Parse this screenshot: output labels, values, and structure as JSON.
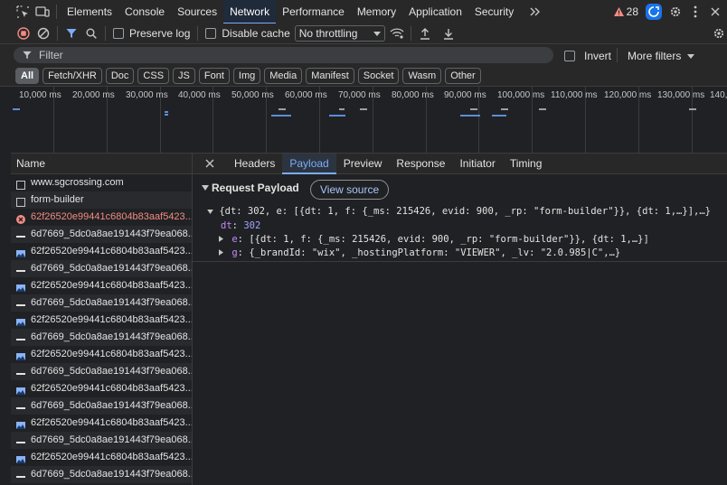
{
  "tabs": {
    "items": [
      "Elements",
      "Console",
      "Sources",
      "Network",
      "Performance",
      "Memory",
      "Application",
      "Security"
    ],
    "active": "Network",
    "issues_count": "28"
  },
  "toolbar": {
    "preserve_log": "Preserve log",
    "disable_cache": "Disable cache",
    "throttling": "No throttling"
  },
  "filter": {
    "placeholder": "Filter",
    "invert": "Invert",
    "more_filters": "More filters"
  },
  "type_chips": [
    "All",
    "Fetch/XHR",
    "Doc",
    "CSS",
    "JS",
    "Font",
    "Img",
    "Media",
    "Manifest",
    "Socket",
    "Wasm",
    "Other"
  ],
  "timeline": {
    "labels": [
      "10,000 ms",
      "20,000 ms",
      "30,000 ms",
      "40,000 ms",
      "50,000 ms",
      "60,000 ms",
      "70,000 ms",
      "80,000 ms",
      "90,000 ms",
      "100,000 ms",
      "110,000 ms",
      "120,000 ms",
      "130,000 ms",
      "140,0"
    ]
  },
  "requests": {
    "header": "Name",
    "items": [
      {
        "name": "www.sgcrossing.com",
        "kind": "doc"
      },
      {
        "name": "form-builder",
        "kind": "doc"
      },
      {
        "name": "62f26520e99441c6804b83aaf5423...",
        "kind": "error"
      },
      {
        "name": "6d7669_5dc0a8ae191443f79ea068...",
        "kind": "dash"
      },
      {
        "name": "62f26520e99441c6804b83aaf5423...",
        "kind": "img"
      },
      {
        "name": "6d7669_5dc0a8ae191443f79ea068...",
        "kind": "dash"
      },
      {
        "name": "62f26520e99441c6804b83aaf5423...",
        "kind": "img"
      },
      {
        "name": "6d7669_5dc0a8ae191443f79ea068...",
        "kind": "dash"
      },
      {
        "name": "62f26520e99441c6804b83aaf5423...",
        "kind": "img"
      },
      {
        "name": "6d7669_5dc0a8ae191443f79ea068...",
        "kind": "dash"
      },
      {
        "name": "62f26520e99441c6804b83aaf5423...",
        "kind": "img"
      },
      {
        "name": "6d7669_5dc0a8ae191443f79ea068...",
        "kind": "dash"
      },
      {
        "name": "62f26520e99441c6804b83aaf5423...",
        "kind": "img"
      },
      {
        "name": "6d7669_5dc0a8ae191443f79ea068...",
        "kind": "dash"
      },
      {
        "name": "62f26520e99441c6804b83aaf5423...",
        "kind": "img"
      },
      {
        "name": "6d7669_5dc0a8ae191443f79ea068...",
        "kind": "dash"
      },
      {
        "name": "62f26520e99441c6804b83aaf5423...",
        "kind": "img"
      },
      {
        "name": "6d7669_5dc0a8ae191443f79ea068...",
        "kind": "dash"
      }
    ]
  },
  "detail_tabs": {
    "items": [
      "Headers",
      "Payload",
      "Preview",
      "Response",
      "Initiator",
      "Timing"
    ],
    "active": "Payload"
  },
  "payload": {
    "section_title": "Request Payload",
    "view_source": "View source",
    "summary": "{dt: 302, e: [{dt: 1, f: {_ms: 215426, evid: 900, _rp: \"form-builder\"}}, {dt: 1,…}],…}",
    "dt_key": "dt",
    "dt_value": "302",
    "e_key": "e",
    "e_value": "[{dt: 1, f: {_ms: 215426, evid: 900, _rp: \"form-builder\"}}, {dt: 1,…}]",
    "g_key": "g",
    "g_value": "{_brandId: \"wix\", _hostingPlatform: \"VIEWER\", _lv: \"2.0.985|C\",…}"
  },
  "colors": {
    "accent": "#7cacf8",
    "error": "#f28b82",
    "warning": "#f28b82"
  }
}
